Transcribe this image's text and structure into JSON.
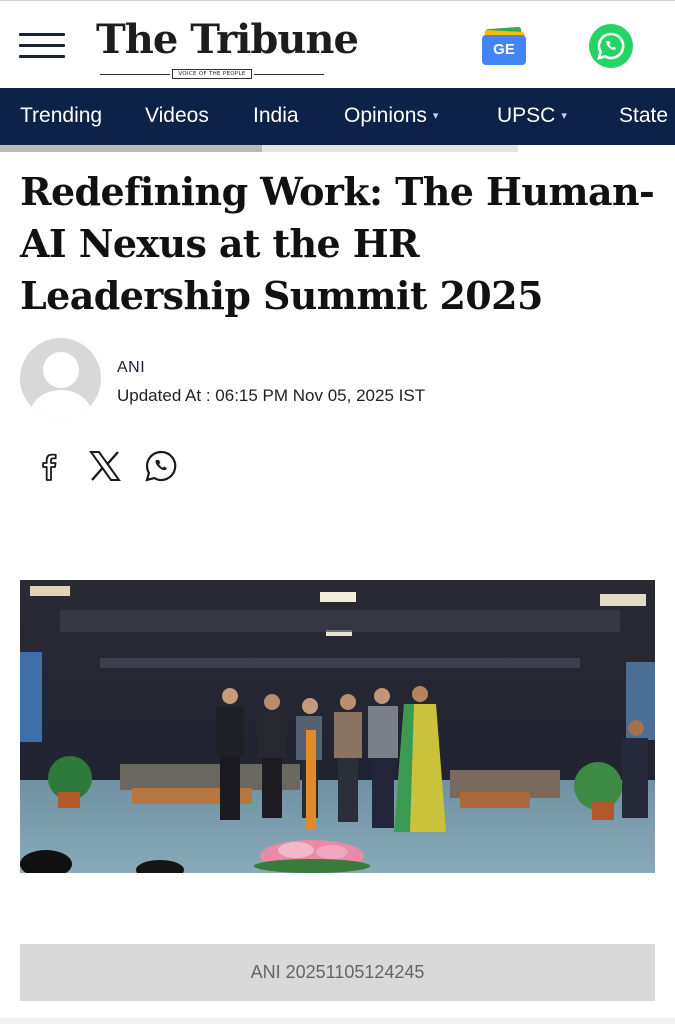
{
  "header": {
    "logo_title": "The Tribune",
    "logo_tagline": "VOICE OF THE PEOPLE",
    "google_news_label": "GE",
    "brand_colors": {
      "navy": "#0c2248",
      "whatsapp": "#25d366",
      "google_blue": "#4285f4"
    }
  },
  "nav": {
    "items": [
      {
        "label": "Trending",
        "caret": ""
      },
      {
        "label": "Videos",
        "caret": ""
      },
      {
        "label": "India",
        "caret": ""
      },
      {
        "label": "Opinions",
        "caret": "▾"
      },
      {
        "label": "UPSC",
        "caret": "▾"
      },
      {
        "label": "State",
        "caret": ""
      }
    ]
  },
  "article": {
    "headline": "Redefining Work: The Human-AI Nexus at the HR Leadership Summit 2025",
    "author": "ANI",
    "updated": "Updated At : 06:15 PM Nov 05, 2025 IST",
    "share_icons": [
      "facebook-icon",
      "x-icon",
      "whatsapp-icon"
    ],
    "image_caption": "ANI 20251105124245"
  }
}
